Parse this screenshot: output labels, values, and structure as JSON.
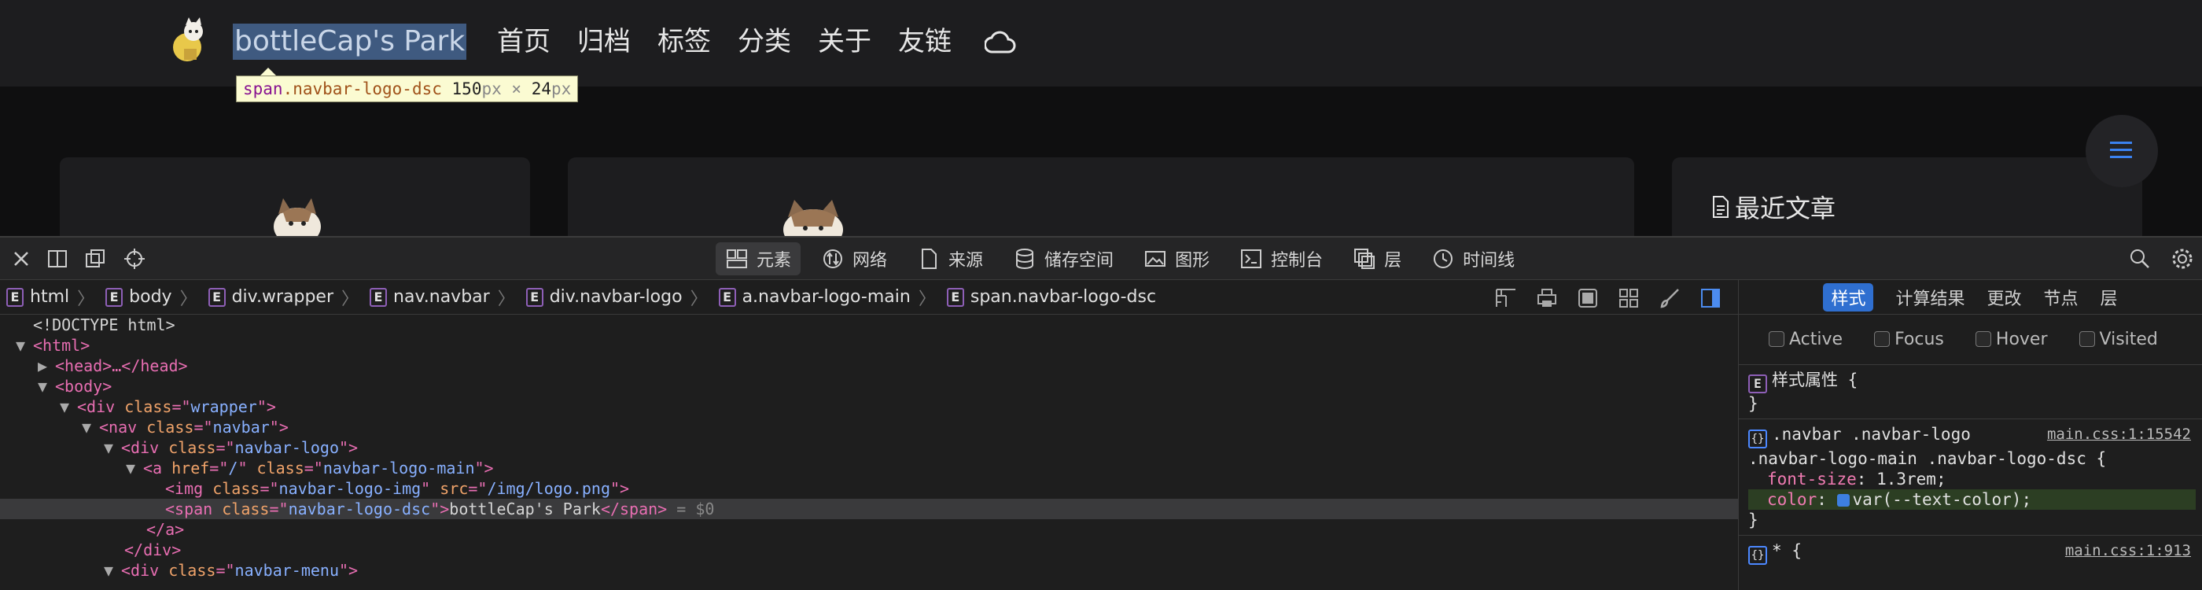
{
  "site": {
    "logo_text": "bottleCap's Park",
    "nav": [
      "首页",
      "归档",
      "标签",
      "分类",
      "关于",
      "友链"
    ],
    "recent_posts_title": "最近文章"
  },
  "tooltip": {
    "tag": "span",
    "cls": ".navbar-logo-dsc",
    "w": "150",
    "x": "×",
    "h": "24",
    "unit": "px"
  },
  "devtools": {
    "tabs": [
      "元素",
      "网络",
      "来源",
      "储存空间",
      "图形",
      "控制台",
      "层",
      "时间线"
    ],
    "breadcrumbs": [
      "html",
      "body",
      "div.wrapper",
      "nav.navbar",
      "div.navbar-logo",
      "a.navbar-logo-main",
      "span.navbar-logo-dsc"
    ],
    "dom": {
      "l0": "<!DOCTYPE html>",
      "html": "<html>",
      "head": "<head>…</head>",
      "body": "<body>",
      "wrapper_attr": "class",
      "wrapper_val": "wrapper",
      "nav_val": "navbar",
      "logo_val": "navbar-logo",
      "a_href": "/",
      "a_val": "navbar-logo-main",
      "img_val": "navbar-logo-img",
      "img_src": "/img/logo.png",
      "span_val": "navbar-logo-dsc",
      "span_text": "bottleCap's Park",
      "span_sel": "= $0",
      "close_a": "</a>",
      "close_div": "</div>",
      "menu_val": "navbar-menu"
    },
    "styles": {
      "tabs": [
        "样式",
        "计算结果",
        "更改",
        "节点",
        "层"
      ],
      "states": [
        "Active",
        "Focus",
        "Hover",
        "Visited"
      ],
      "inline_label": "样式属性",
      "rule1_selector_a": ".navbar .navbar-logo",
      "rule1_selector_b": ".navbar-logo-main .navbar-logo-dsc",
      "rule1_src": "main.css:1:15542",
      "p1_name": "font-size",
      "p1_val": "1.3rem;",
      "p2_name": "color",
      "p2_val": "var(--text-color);",
      "rule2_selector": "*",
      "rule2_src": "main.css:1:913"
    }
  },
  "colors": {
    "accent": "#2f6fd0",
    "selection": "#3f5a80",
    "tag": "#e86eb2",
    "attr": "#f0a36a",
    "value": "#88b0ff"
  }
}
